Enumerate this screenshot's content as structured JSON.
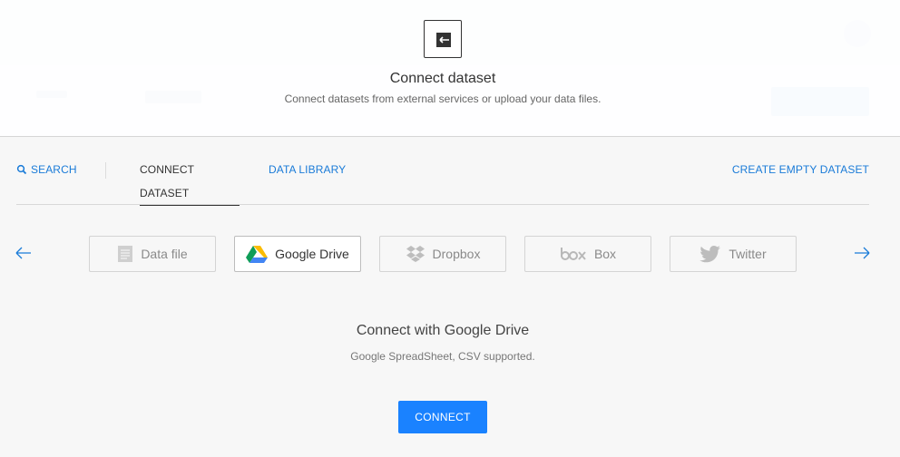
{
  "header": {
    "title": "Connect dataset",
    "subtitle": "Connect datasets from external services or upload your data files.",
    "icon": "connect-arrow-icon"
  },
  "tabs": {
    "search": "SEARCH",
    "connect": "CONNECT DATASET",
    "library": "DATA LIBRARY",
    "create": "CREATE EMPTY DATASET",
    "active": "CONNECT DATASET"
  },
  "sources": [
    {
      "label": "Data file",
      "icon": "document-icon"
    },
    {
      "label": "Google Drive",
      "icon": "google-drive-icon"
    },
    {
      "label": "Dropbox",
      "icon": "dropbox-icon"
    },
    {
      "label": "Box",
      "icon": "box-logo-icon"
    },
    {
      "label": "Twitter",
      "icon": "twitter-icon"
    }
  ],
  "selected_source": "Google Drive",
  "detail": {
    "title": "Connect with Google Drive",
    "subtitle": "Google SpreadSheet, CSV supported.",
    "button": "CONNECT"
  },
  "colors": {
    "accent": "#1a82ff",
    "link": "#1a7bd8"
  }
}
